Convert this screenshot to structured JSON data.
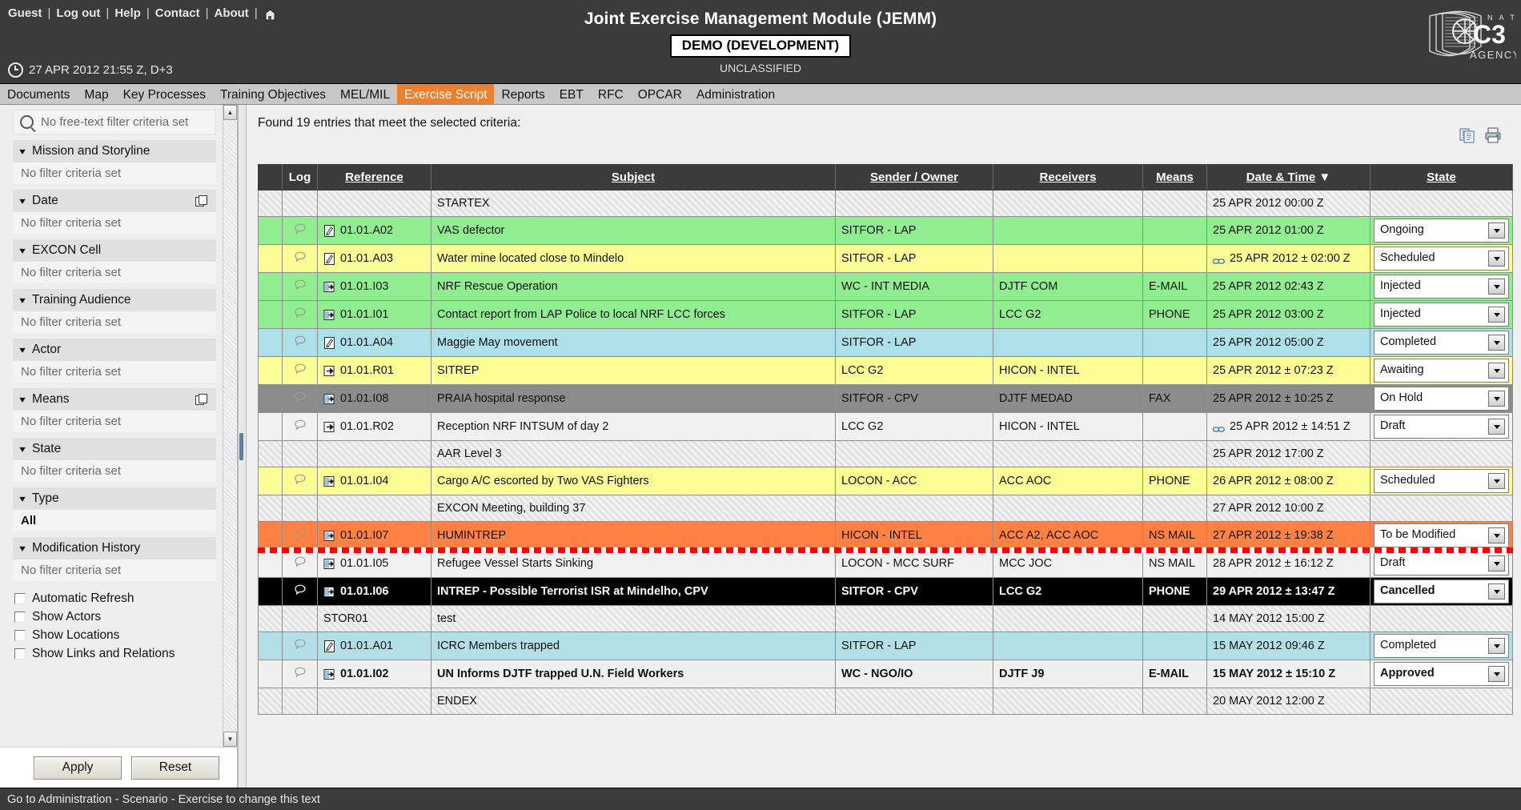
{
  "header": {
    "links": [
      "Guest",
      "Log out",
      "Help",
      "Contact",
      "About"
    ],
    "home_icon": "home-icon",
    "clock_icon": "clock-icon",
    "datetime": "27 APR 2012 21:55 Z, D+3",
    "title": "Joint Exercise Management Module (JEMM)",
    "demo_badge": "DEMO (DEVELOPMENT)",
    "classification": "UNCLASSIFIED",
    "logo": {
      "line1": "N A T O",
      "line2": "C3",
      "line3": "AGENCY"
    }
  },
  "nav": {
    "items": [
      {
        "label": "Documents",
        "active": false
      },
      {
        "label": "Map",
        "active": false
      },
      {
        "label": "Key Processes",
        "active": false
      },
      {
        "label": "Training Objectives",
        "active": false
      },
      {
        "label": "MEL/MIL",
        "active": false
      },
      {
        "label": "Exercise Script",
        "active": true
      },
      {
        "label": "Reports",
        "active": false
      },
      {
        "label": "EBT",
        "active": false
      },
      {
        "label": "RFC",
        "active": false
      },
      {
        "label": "OPCAR",
        "active": false
      },
      {
        "label": "Administration",
        "active": false
      }
    ]
  },
  "sidebar": {
    "freetext_placeholder": "No free-text filter criteria set",
    "search_icon": "search-icon",
    "groups": [
      {
        "title": "Mission and Storyline",
        "value": "No filter criteria set",
        "has_copy": false
      },
      {
        "title": "Date",
        "value": "No filter criteria set",
        "has_copy": true
      },
      {
        "title": "EXCON Cell",
        "value": "No filter criteria set",
        "has_copy": false
      },
      {
        "title": "Training Audience",
        "value": "No filter criteria set",
        "has_copy": false
      },
      {
        "title": "Actor",
        "value": "No filter criteria set",
        "has_copy": false
      },
      {
        "title": "Means",
        "value": "No filter criteria set",
        "has_copy": true
      },
      {
        "title": "State",
        "value": "No filter criteria set",
        "has_copy": false
      },
      {
        "title": "Type",
        "value": "All",
        "has_copy": false,
        "bold": true
      },
      {
        "title": "Modification History",
        "value": "No filter criteria set",
        "has_copy": false
      }
    ],
    "checkboxes": [
      {
        "label": "Automatic Refresh",
        "checked": false
      },
      {
        "label": "Show Actors",
        "checked": false
      },
      {
        "label": "Show Locations",
        "checked": false
      },
      {
        "label": "Show Links and Relations",
        "checked": false
      }
    ],
    "apply_label": "Apply",
    "reset_label": "Reset"
  },
  "main": {
    "found_text": "Found 19 entries that meet the selected criteria:",
    "tool_icons": [
      "copy-icon",
      "print-icon"
    ],
    "columns": [
      {
        "key": "mark",
        "label": "",
        "sortable": false
      },
      {
        "key": "log",
        "label": "Log",
        "sortable": false
      },
      {
        "key": "reference",
        "label": "Reference",
        "sortable": true
      },
      {
        "key": "subject",
        "label": "Subject",
        "sortable": true
      },
      {
        "key": "sender",
        "label": "Sender / Owner",
        "sortable": true
      },
      {
        "key": "receivers",
        "label": "Receivers",
        "sortable": true
      },
      {
        "key": "means",
        "label": "Means",
        "sortable": true
      },
      {
        "key": "datetime",
        "label": "Date & Time",
        "sortable": true,
        "sort_dir": "desc"
      },
      {
        "key": "state",
        "label": "State",
        "sortable": true
      }
    ],
    "rows": [
      {
        "style": "sep",
        "log": "",
        "icon": "",
        "reference": "",
        "subject": "STARTEX",
        "sender": "",
        "receivers": "",
        "means": "",
        "datetime": "25 APR 2012 00:00 Z",
        "date_link": false,
        "state": ""
      },
      {
        "style": "green",
        "log": "bubble",
        "icon": "activity-icon",
        "reference": "01.01.A02",
        "subject": "VAS defector",
        "sender": "SITFOR - LAP",
        "receivers": "",
        "means": "",
        "datetime": "25 APR 2012 01:00 Z",
        "date_link": false,
        "state": "Ongoing"
      },
      {
        "style": "yellow",
        "log": "bubble",
        "icon": "activity-icon",
        "reference": "01.01.A03",
        "subject": "Water mine located close to Mindelo",
        "sender": "SITFOR - LAP",
        "receivers": "",
        "means": "",
        "datetime": "25 APR 2012 ± 02:00 Z",
        "date_link": true,
        "state": "Scheduled"
      },
      {
        "style": "green",
        "log": "bubble",
        "icon": "inject-icon",
        "reference": "01.01.I03",
        "subject": "NRF Rescue Operation",
        "sender": "WC - INT MEDIA",
        "receivers": "DJTF COM",
        "means": "E-MAIL",
        "datetime": "25 APR 2012 02:43 Z",
        "date_link": false,
        "state": "Injected"
      },
      {
        "style": "green",
        "log": "bubble",
        "icon": "inject-icon",
        "reference": "01.01.I01",
        "subject": "Contact report from LAP Police to local NRF LCC forces",
        "sender": "SITFOR - LAP",
        "receivers": "LCC G2",
        "means": "PHONE",
        "datetime": "25 APR 2012 03:00 Z",
        "date_link": false,
        "state": "Injected"
      },
      {
        "style": "blue",
        "log": "bubble",
        "icon": "activity-icon",
        "reference": "01.01.A04",
        "subject": "Maggie May movement",
        "sender": "SITFOR - LAP",
        "receivers": "",
        "means": "",
        "datetime": "25 APR 2012 05:00 Z",
        "date_link": false,
        "state": "Completed"
      },
      {
        "style": "yellow",
        "log": "bubble",
        "icon": "report-icon",
        "reference": "01.01.R01",
        "subject": "SITREP",
        "sender": "LCC G2",
        "receivers": "HICON - INTEL",
        "means": "",
        "datetime": "25 APR 2012 ± 07:23 Z",
        "date_link": false,
        "state": "Awaiting"
      },
      {
        "style": "gray",
        "log": "bubble",
        "icon": "inject-icon",
        "reference": "01.01.I08",
        "subject": "PRAIA hospital response",
        "sender": "SITFOR - CPV",
        "receivers": "DJTF MEDAD",
        "means": "FAX",
        "datetime": "25 APR 2012 ± 10:25 Z",
        "date_link": false,
        "state": "On Hold"
      },
      {
        "style": "white",
        "log": "bubble",
        "icon": "report-icon",
        "reference": "01.01.R02",
        "subject": "Reception NRF INTSUM of day 2",
        "sender": "LCC G2",
        "receivers": "HICON - INTEL",
        "means": "",
        "datetime": "25 APR 2012 ± 14:51 Z",
        "date_link": true,
        "state": "Draft"
      },
      {
        "style": "sep",
        "log": "",
        "icon": "",
        "reference": "",
        "subject": "AAR Level 3",
        "sender": "",
        "receivers": "",
        "means": "",
        "datetime": "25 APR 2012 17:00 Z",
        "date_link": false,
        "state": ""
      },
      {
        "style": "yellow",
        "log": "bubble",
        "icon": "inject-icon",
        "reference": "01.01.I04",
        "subject": "Cargo A/C escorted by Two VAS Fighters",
        "sender": "LOCON - ACC",
        "receivers": "ACC AOC",
        "means": "PHONE",
        "datetime": "26 APR 2012 ± 08:00 Z",
        "date_link": false,
        "state": "Scheduled"
      },
      {
        "style": "sep",
        "log": "",
        "icon": "",
        "reference": "",
        "subject": "EXCON Meeting, building 37",
        "sender": "",
        "receivers": "",
        "means": "",
        "datetime": "27 APR 2012 10:00 Z",
        "date_link": false,
        "state": ""
      },
      {
        "style": "orange",
        "log": "bubble",
        "icon": "inject-icon",
        "reference": "01.01.I07",
        "subject": "HUMINTREP",
        "sender": "HICON - INTEL",
        "receivers": "ACC A2, ACC AOC",
        "means": "NS MAIL",
        "datetime": "27 APR 2012 ± 19:38 Z",
        "date_link": false,
        "state": "To be Modified"
      },
      {
        "style": "white",
        "log": "bubble",
        "icon": "inject-icon",
        "reference": "01.01.I05",
        "subject": "Refugee Vessel Starts Sinking",
        "sender": "LOCON - MCC SURF",
        "receivers": "MCC JOC",
        "means": "NS MAIL",
        "datetime": "28 APR 2012 ± 16:12 Z",
        "date_link": false,
        "state": "Draft"
      },
      {
        "style": "black",
        "log": "bubble",
        "icon": "inject-icon",
        "reference": "01.01.I06",
        "subject": "INTREP - Possible Terrorist ISR at Mindelho, CPV",
        "sender": "SITFOR - CPV",
        "receivers": "LCC G2",
        "means": "PHONE",
        "datetime": "29 APR 2012 ± 13:47 Z",
        "date_link": false,
        "state": "Cancelled"
      },
      {
        "style": "sep",
        "log": "",
        "icon": "",
        "reference": "STOR01",
        "subject": "test",
        "sender": "",
        "receivers": "",
        "means": "",
        "datetime": "14 MAY 2012 15:00 Z",
        "date_link": false,
        "state": ""
      },
      {
        "style": "blue2",
        "log": "bubble",
        "icon": "activity-icon",
        "reference": "01.01.A01",
        "subject": "ICRC Members trapped",
        "sender": "SITFOR - LAP",
        "receivers": "",
        "means": "",
        "datetime": "15 MAY 2012 09:46 Z",
        "date_link": false,
        "state": "Completed"
      },
      {
        "style": "bold",
        "log": "bubble",
        "icon": "inject-icon",
        "reference": "01.01.I02",
        "subject": "UN Informs DJTF trapped U.N. Field Workers",
        "sender": "WC - NGO/IO",
        "receivers": "DJTF J9",
        "means": "E-MAIL",
        "datetime": "15 MAY 2012 ± 15:10 Z",
        "date_link": false,
        "state": "Approved"
      },
      {
        "style": "sep",
        "log": "",
        "icon": "",
        "reference": "",
        "subject": "ENDEX",
        "sender": "",
        "receivers": "",
        "means": "",
        "datetime": "20 MAY 2012 12:00 Z",
        "date_link": false,
        "state": ""
      }
    ],
    "current_time_marker_after_row": 12
  },
  "statusbar": {
    "text": "Go to Administration - Scenario - Exercise to change this text"
  },
  "colors": {
    "accent": "#ee7f2d",
    "header_bg": "#3b3b3b",
    "nav_bg": "#c8c8c8",
    "green": "#90ee90",
    "yellow": "#fdfd96",
    "blue": "#ade0e8",
    "orange": "#ff8243",
    "gray": "#8c8c8c",
    "marker_red": "#ff0000"
  }
}
